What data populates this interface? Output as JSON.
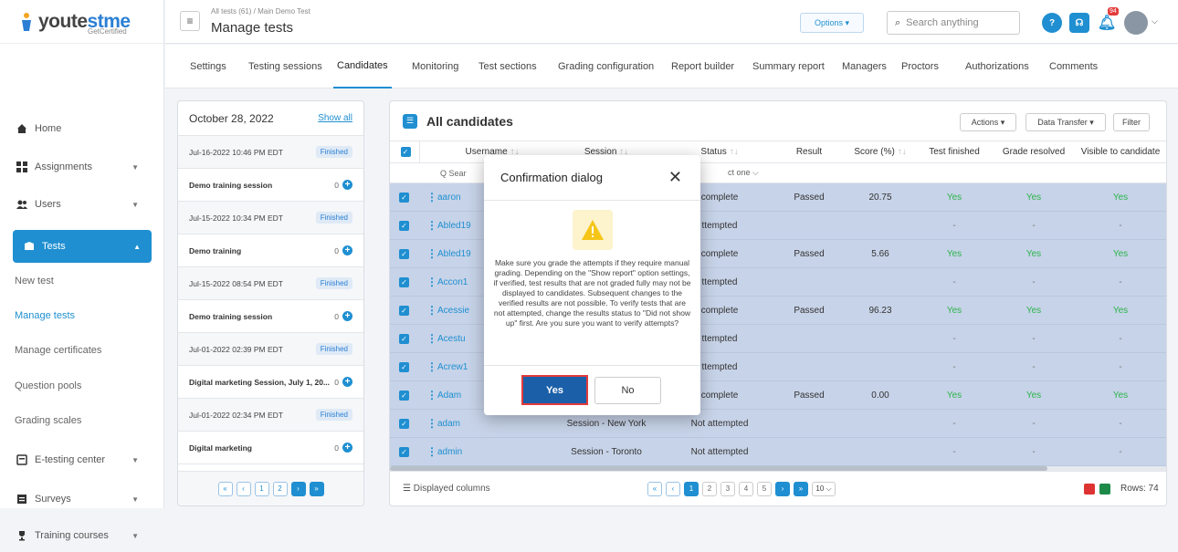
{
  "brand": {
    "name_a": "youte",
    "name_b": "stme",
    "tagline": "GetCertified"
  },
  "nav": {
    "home": "Home",
    "assignments": "Assignments",
    "users": "Users",
    "tests": "Tests",
    "sub": [
      "New test",
      "Manage tests",
      "Manage certificates",
      "Question pools",
      "Grading scales"
    ],
    "etesting": "E-testing center",
    "surveys": "Surveys",
    "training": "Training courses"
  },
  "header": {
    "breadcrumb": "All tests (61)  /  Main Demo Test",
    "title": "Manage tests",
    "options": "Options ▾",
    "search_placeholder": "Search anything",
    "notif_count": "94"
  },
  "tabs": [
    "Settings",
    "Testing sessions",
    "Candidates",
    "Monitoring",
    "Test sections",
    "Grading configuration",
    "Report builder",
    "Summary report",
    "Managers",
    "Proctors",
    "Authorizations",
    "Comments"
  ],
  "sessions": {
    "date": "October 28, 2022",
    "show_all": "Show all",
    "rows": [
      {
        "date": "Jul-16-2022 10:46 PM EDT",
        "status": "Finished",
        "name": "Demo training session",
        "count": "0"
      },
      {
        "date": "Jul-15-2022 10:34 PM EDT",
        "status": "Finished",
        "name": "Demo training",
        "count": "0"
      },
      {
        "date": "Jul-15-2022 08:54 PM EDT",
        "status": "Finished",
        "name": "Demo training session",
        "count": "0"
      },
      {
        "date": "Jul-01-2022 02:39 PM EDT",
        "status": "Finished",
        "name": "Digital marketing Session, July 1, 20...",
        "count": "0"
      },
      {
        "date": "Jul-01-2022 02:34 PM EDT",
        "status": "Finished",
        "name": "Digital marketing",
        "count": "0"
      }
    ],
    "pager": [
      "«",
      "‹",
      "1",
      "2",
      "›",
      "»"
    ]
  },
  "candidates": {
    "title": "All candidates",
    "actions": "Actions ▾",
    "data_transfer": "Data Transfer ▾",
    "filter": "Filter",
    "columns": [
      "Username",
      "Session",
      "Status",
      "Result",
      "Score (%)",
      "Test finished",
      "Grade resolved",
      "Visible to candidate"
    ],
    "filter_search": "Q Sear",
    "filter_select": "ct one ⌵",
    "rows": [
      {
        "user": "aaron",
        "session": "",
        "status": "complete",
        "result": "Passed",
        "score": "20.75",
        "finished": "Yes",
        "resolved": "Yes",
        "visible": "Yes"
      },
      {
        "user": "Abled19",
        "session": "",
        "status": "ttempted",
        "result": "",
        "score": "",
        "finished": "-",
        "resolved": "-",
        "visible": "-"
      },
      {
        "user": "Abled19",
        "session": "",
        "status": "complete",
        "result": "Passed",
        "score": "5.66",
        "finished": "Yes",
        "resolved": "Yes",
        "visible": "Yes"
      },
      {
        "user": "Accon1",
        "session": "",
        "status": "ttempted",
        "result": "",
        "score": "",
        "finished": "-",
        "resolved": "-",
        "visible": "-"
      },
      {
        "user": "Acessie",
        "session": "",
        "status": "complete",
        "result": "Passed",
        "score": "96.23",
        "finished": "Yes",
        "resolved": "Yes",
        "visible": "Yes"
      },
      {
        "user": "Acestu",
        "session": "",
        "status": "ttempted",
        "result": "",
        "score": "",
        "finished": "-",
        "resolved": "-",
        "visible": "-"
      },
      {
        "user": "Acrew1",
        "session": "",
        "status": "ttempted",
        "result": "",
        "score": "",
        "finished": "-",
        "resolved": "-",
        "visible": "-"
      },
      {
        "user": "Adam",
        "session": "",
        "status": "complete",
        "result": "Passed",
        "score": "0.00",
        "finished": "Yes",
        "resolved": "Yes",
        "visible": "Yes"
      },
      {
        "user": "adam",
        "session": "Session - New York",
        "status": "Not attempted",
        "result": "",
        "score": "",
        "finished": "-",
        "resolved": "-",
        "visible": "-"
      },
      {
        "user": "admin",
        "session": "Session - Toronto",
        "status": "Not attempted",
        "result": "",
        "score": "",
        "finished": "-",
        "resolved": "-",
        "visible": "-"
      }
    ],
    "displayed_columns": "Displayed columns",
    "pager": [
      "«",
      "‹",
      "1",
      "2",
      "3",
      "4",
      "5",
      "›",
      "»"
    ],
    "page_size": "10 ⌵",
    "rows_label": "Rows: 74"
  },
  "dialog": {
    "title": "Confirmation dialog",
    "message": "Make sure you grade the attempts if they require manual grading. Depending on the \"Show report\" option settings, if verified, test results that are not graded fully may not be displayed to candidates. Subsequent changes to the verified results are not possible. To verify tests that are not attempted, change the results status to \"Did not show up\" first. Are you sure you want to verify attempts?",
    "yes": "Yes",
    "no": "No"
  }
}
